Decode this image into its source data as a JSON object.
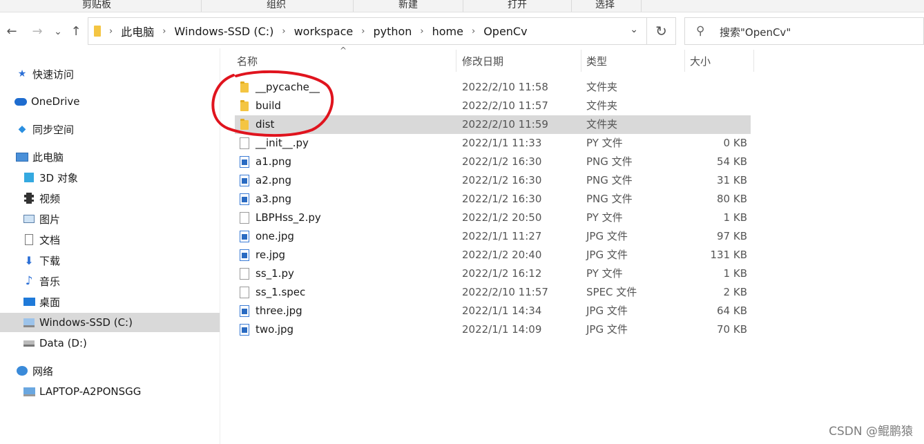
{
  "ribbon": {
    "groups": [
      "剪贴板",
      "组织",
      "新建",
      "打开",
      "选择"
    ]
  },
  "nav": {
    "back_icon": "←",
    "forward_icon": "→",
    "recent_icon": "⌄",
    "up_icon": "↑",
    "breadcrumbs": [
      "此电脑",
      "Windows-SSD (C:)",
      "workspace",
      "python",
      "home",
      "OpenCv"
    ],
    "refresh_icon": "↻",
    "search_placeholder": "搜索\"OpenCv\""
  },
  "sidebar": {
    "items": [
      {
        "label": "快速访问",
        "icon": "star-icon"
      },
      {
        "label": "OneDrive",
        "icon": "cloud-icon"
      },
      {
        "label": "同步空间",
        "icon": "sync-icon"
      },
      {
        "label": "此电脑",
        "icon": "computer-icon"
      },
      {
        "label": "3D 对象",
        "icon": "cube-icon"
      },
      {
        "label": "视频",
        "icon": "film-icon"
      },
      {
        "label": "图片",
        "icon": "picture-icon"
      },
      {
        "label": "文档",
        "icon": "document-icon"
      },
      {
        "label": "下载",
        "icon": "download-icon"
      },
      {
        "label": "音乐",
        "icon": "music-icon"
      },
      {
        "label": "桌面",
        "icon": "desktop-icon"
      },
      {
        "label": "Windows-SSD (C:)",
        "icon": "drive-c-icon",
        "selected": true
      },
      {
        "label": "Data (D:)",
        "icon": "drive-d-icon"
      },
      {
        "label": "网络",
        "icon": "network-icon"
      },
      {
        "label": "LAPTOP-A2PONSGG",
        "icon": "laptop-icon"
      }
    ]
  },
  "columns": {
    "name": "名称",
    "date": "修改日期",
    "type": "类型",
    "size": "大小"
  },
  "files": [
    {
      "name": "__pycache__",
      "date": "2022/2/10 11:58",
      "type": "文件夹",
      "size": "",
      "kind": "folder"
    },
    {
      "name": "build",
      "date": "2022/2/10 11:57",
      "type": "文件夹",
      "size": "",
      "kind": "folder"
    },
    {
      "name": "dist",
      "date": "2022/2/10 11:59",
      "type": "文件夹",
      "size": "",
      "kind": "folder",
      "selected": true
    },
    {
      "name": "__init__.py",
      "date": "2022/1/1 11:33",
      "type": "PY 文件",
      "size": "0 KB",
      "kind": "doc"
    },
    {
      "name": "a1.png",
      "date": "2022/1/2 16:30",
      "type": "PNG 文件",
      "size": "54 KB",
      "kind": "image"
    },
    {
      "name": "a2.png",
      "date": "2022/1/2 16:30",
      "type": "PNG 文件",
      "size": "31 KB",
      "kind": "image"
    },
    {
      "name": "a3.png",
      "date": "2022/1/2 16:30",
      "type": "PNG 文件",
      "size": "80 KB",
      "kind": "image"
    },
    {
      "name": "LBPHss_2.py",
      "date": "2022/1/2 20:50",
      "type": "PY 文件",
      "size": "1 KB",
      "kind": "doc"
    },
    {
      "name": "one.jpg",
      "date": "2022/1/1 11:27",
      "type": "JPG 文件",
      "size": "97 KB",
      "kind": "image"
    },
    {
      "name": "re.jpg",
      "date": "2022/1/2 20:40",
      "type": "JPG 文件",
      "size": "131 KB",
      "kind": "image"
    },
    {
      "name": "ss_1.py",
      "date": "2022/1/2 16:12",
      "type": "PY 文件",
      "size": "1 KB",
      "kind": "doc"
    },
    {
      "name": "ss_1.spec",
      "date": "2022/2/10 11:57",
      "type": "SPEC 文件",
      "size": "2 KB",
      "kind": "doc"
    },
    {
      "name": "three.jpg",
      "date": "2022/1/1 14:34",
      "type": "JPG 文件",
      "size": "64 KB",
      "kind": "image"
    },
    {
      "name": "two.jpg",
      "date": "2022/1/1 14:09",
      "type": "JPG 文件",
      "size": "70 KB",
      "kind": "image"
    }
  ],
  "watermark": "CSDN @鲲鹏猿",
  "colors": {
    "selection": "#d9d9d9",
    "annotation": "#e0141e",
    "folder": "#f4c542"
  }
}
